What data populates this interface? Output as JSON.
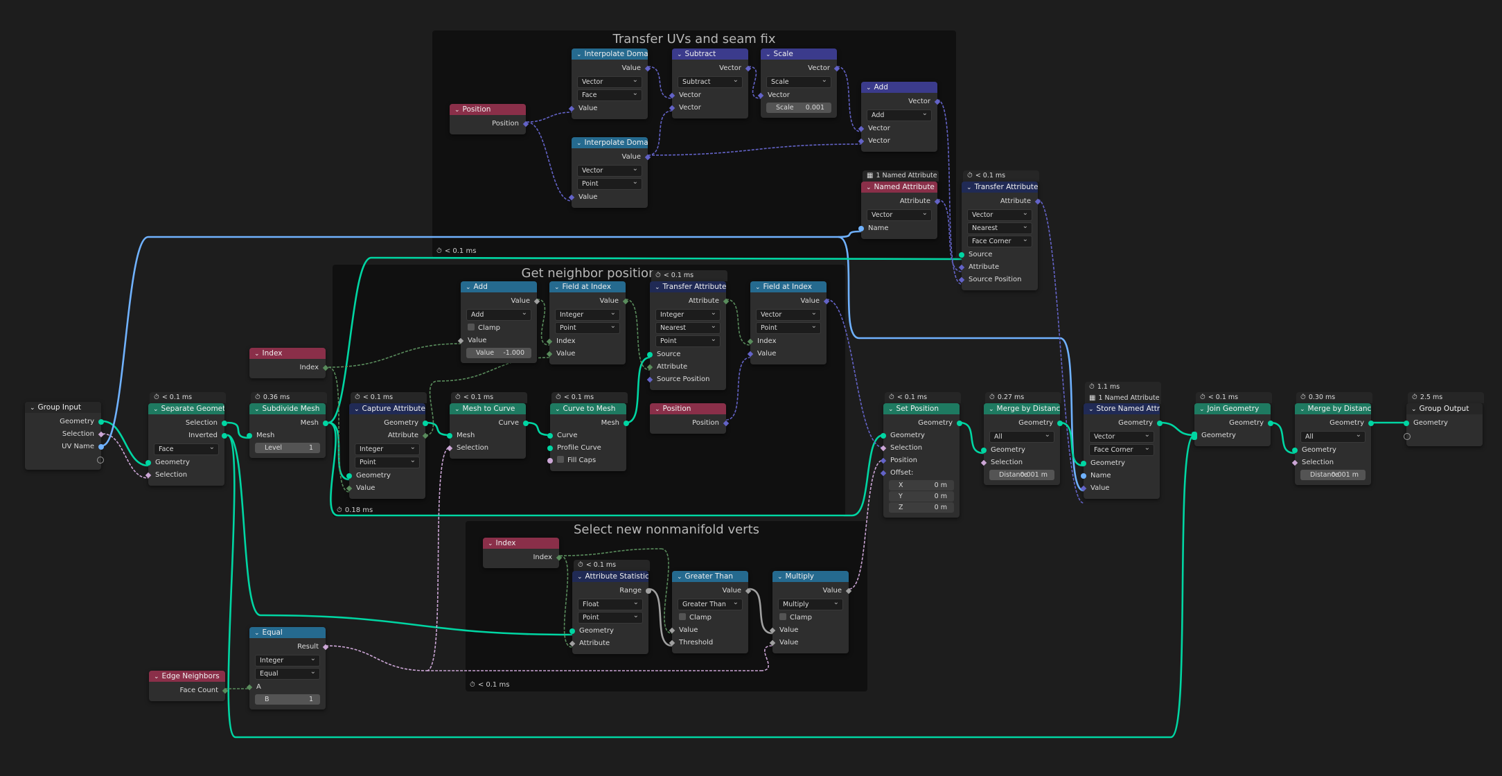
{
  "colors": {
    "background": "#1d1d1d",
    "frame": "#101010",
    "node_body": "#2e2e2e",
    "header_geometry": "#1e7a61",
    "header_input": "#8a2f49",
    "header_converter": "#256a8f",
    "header_vector": "#3b3b8c",
    "header_attribute": "#202a55",
    "socket_geometry": "#00d6a3",
    "socket_vector": "#6363c7",
    "socket_integer": "#598c5c",
    "socket_boolean": "#cca6d6",
    "socket_string": "#70b2ff",
    "socket_float": "#a1a1a1"
  },
  "icons": {
    "timer": "stopwatch-icon",
    "named_attribute": "named-attribute-icon",
    "collapse": "chevron-down-icon",
    "dropdown": "dropdown-arrow-icon"
  },
  "frames": {
    "transfer": {
      "title": "Transfer UVs and seam fix",
      "timer": "< 0.1 ms"
    },
    "neighbor": {
      "title": "Get neighbor position",
      "timer": "0.18 ms"
    },
    "nonmanifold": {
      "title": "Select new nonmanifold verts",
      "timer": "< 0.1 ms"
    }
  },
  "nodes": {
    "group_input": {
      "title": "Group Input",
      "outputs": [
        "Geometry",
        "Selection",
        "UV Name"
      ]
    },
    "separate_geometry": {
      "timer": "< 0.1 ms",
      "title": "Separate Geometry",
      "outputs": [
        "Selection",
        "Inverted"
      ],
      "domain": "Face",
      "inputs": [
        "Geometry",
        "Selection"
      ]
    },
    "subdivide_mesh": {
      "timer": "0.36 ms",
      "title": "Subdivide Mesh",
      "output": "Mesh",
      "input": "Mesh",
      "level_label": "Level",
      "level_value": "1"
    },
    "index1": {
      "title": "Index",
      "output": "Index"
    },
    "capture_attribute": {
      "timer": "< 0.1 ms",
      "title": "Capture Attribute",
      "outputs": [
        "Geometry",
        "Attribute"
      ],
      "type": "Integer",
      "domain": "Point",
      "inputs": [
        "Geometry",
        "Value"
      ]
    },
    "add_math": {
      "title": "Add",
      "output": "Value",
      "operation": "Add",
      "clamp": "Clamp",
      "input": "Value",
      "value_label": "Value",
      "value": "-1.000"
    },
    "field_at_index1": {
      "title": "Field at Index",
      "output": "Value",
      "type": "Integer",
      "domain": "Point",
      "inputs": [
        "Index",
        "Value"
      ]
    },
    "transfer_attribute1": {
      "timer": "< 0.1 ms",
      "title": "Transfer Attribute",
      "output": "Attribute",
      "type": "Integer",
      "mapping": "Nearest",
      "domain": "Point",
      "inputs": [
        "Source",
        "Attribute",
        "Source Position"
      ]
    },
    "field_at_index2": {
      "title": "Field at Index",
      "output": "Value",
      "type": "Vector",
      "domain": "Point",
      "inputs": [
        "Index",
        "Value"
      ]
    },
    "mesh_to_curve": {
      "timer": "< 0.1 ms",
      "title": "Mesh to Curve",
      "output": "Curve",
      "inputs": [
        "Mesh",
        "Selection"
      ]
    },
    "curve_to_mesh": {
      "timer": "< 0.1 ms",
      "title": "Curve to Mesh",
      "output": "Mesh",
      "inputs": [
        "Curve",
        "Profile Curve"
      ],
      "fill_caps": "Fill Caps"
    },
    "position2": {
      "title": "Position",
      "output": "Position"
    },
    "position1": {
      "title": "Position",
      "output": "Position"
    },
    "interp1": {
      "title": "Interpolate Domain",
      "output": "Value",
      "type": "Vector",
      "domain": "Face",
      "input": "Value"
    },
    "interp2": {
      "title": "Interpolate Domain",
      "output": "Value",
      "type": "Vector",
      "domain": "Point",
      "input": "Value"
    },
    "subtract": {
      "title": "Subtract",
      "output": "Vector",
      "operation": "Subtract",
      "inputs": [
        "Vector",
        "Vector"
      ]
    },
    "scale": {
      "title": "Scale",
      "output": "Vector",
      "operation": "Scale",
      "input": "Vector",
      "scale_label": "Scale",
      "scale_value": "0.001"
    },
    "add_vec": {
      "title": "Add",
      "output": "Vector",
      "operation": "Add",
      "inputs": [
        "Vector",
        "Vector"
      ]
    },
    "named_attribute": {
      "info": "1 Named Attribute",
      "title": "Named Attribute",
      "output": "Attribute",
      "type": "Vector",
      "input": "Name"
    },
    "transfer_attribute2": {
      "timer": "< 0.1 ms",
      "title": "Transfer Attribute",
      "output": "Attribute",
      "type": "Vector",
      "mapping": "Nearest",
      "domain": "Face Corner",
      "inputs": [
        "Source",
        "Attribute",
        "Source Position"
      ]
    },
    "index2": {
      "title": "Index",
      "output": "Index"
    },
    "attribute_statistic": {
      "timer": "< 0.1 ms",
      "title": "Attribute Statistic",
      "output": "Range",
      "type": "Float",
      "domain": "Point",
      "inputs": [
        "Geometry",
        "Attribute"
      ]
    },
    "greater_than": {
      "title": "Greater Than",
      "output": "Value",
      "operation": "Greater Than",
      "clamp": "Clamp",
      "inputs": [
        "Value",
        "Threshold"
      ]
    },
    "multiply": {
      "title": "Multiply",
      "output": "Value",
      "operation": "Multiply",
      "clamp": "Clamp",
      "inputs": [
        "Value",
        "Value"
      ]
    },
    "equal": {
      "title": "Equal",
      "output": "Result",
      "type": "Integer",
      "operation": "Equal",
      "input_a": "A",
      "b_label": "B",
      "b_value": "1"
    },
    "edge_neighbors": {
      "title": "Edge Neighbors",
      "output": "Face Count"
    },
    "set_position": {
      "timer": "< 0.1 ms",
      "title": "Set Position",
      "output": "Geometry",
      "inputs": [
        "Geometry",
        "Selection",
        "Position",
        "Offset:"
      ],
      "offset": [
        {
          "axis": "X",
          "value": "0 m"
        },
        {
          "axis": "Y",
          "value": "0 m"
        },
        {
          "axis": "Z",
          "value": "0 m"
        }
      ]
    },
    "merge1": {
      "timer": "0.27 ms",
      "title": "Merge by Distance",
      "output": "Geometry",
      "mode": "All",
      "inputs": [
        "Geometry",
        "Selection"
      ],
      "distance_label": "Distance",
      "distance_value": "0.001 m"
    },
    "store_named": {
      "timer": "1.1 ms",
      "info": "1 Named Attribute",
      "title": "Store Named Attribute",
      "output": "Geometry",
      "type": "Vector",
      "domain": "Face Corner",
      "inputs": [
        "Geometry",
        "Name",
        "Value"
      ]
    },
    "join_geometry": {
      "timer": "< 0.1 ms",
      "title": "Join Geometry",
      "output": "Geometry",
      "input": "Geometry"
    },
    "merge2": {
      "timer": "0.30 ms",
      "title": "Merge by Distance",
      "output": "Geometry",
      "mode": "All",
      "inputs": [
        "Geometry",
        "Selection"
      ],
      "distance_label": "Distance",
      "distance_value": "0.001 m"
    },
    "group_output": {
      "timer": "2.5 ms",
      "title": "Group Output",
      "input": "Geometry"
    }
  }
}
